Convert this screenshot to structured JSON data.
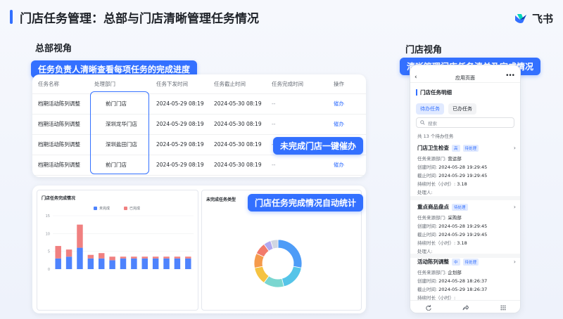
{
  "page": {
    "title": "门店任务管理：总部与门店清晰管理任务情况",
    "logo_text": "飞书"
  },
  "hq": {
    "heading": "总部视角",
    "pill_table": "任务负责人清晰查看每项任务的完成进度",
    "pill_remind": "未完成门店一键催办",
    "pill_stats": "门店任务完成情况自动统计",
    "table": {
      "headers": [
        "任务名称",
        "处理部门",
        "任务下发时间",
        "任务截止时间",
        "任务完成时间",
        "操作"
      ],
      "rows": [
        {
          "name": "档期活动陈列调整",
          "dept": "前门门店",
          "issued": "2024-05-29 08:19",
          "deadline": "2024-05-30 08:19",
          "done": "--",
          "action": "催办"
        },
        {
          "name": "档期活动陈列调整",
          "dept": "深圳龙华门店",
          "issued": "2024-05-29 08:19",
          "deadline": "2024-05-30 08:19",
          "done": "--",
          "action": "催办"
        },
        {
          "name": "档期活动陈列调整",
          "dept": "深圳盐田门店",
          "issued": "2024-05-29 08:19",
          "deadline": "2024-05-30 08:19",
          "done": "--",
          "action": "催办"
        },
        {
          "name": "档期活动陈列调整",
          "dept": "前门门店",
          "issued": "2024-05-29 08:19",
          "deadline": "2024-05-30 08:19",
          "done": "--",
          "action": "催办"
        }
      ]
    }
  },
  "chart_data": [
    {
      "type": "bar",
      "title": "门店任务完成情况",
      "series": [
        {
          "name": "未完成",
          "values": [
            3,
            3.5,
            6,
            3,
            3,
            2.5,
            3,
            3,
            3,
            3,
            3,
            3,
            3
          ]
        },
        {
          "name": "已完成",
          "values": [
            3.5,
            2,
            6.5,
            1,
            1.5,
            1,
            0.5,
            0.5,
            0.5,
            0.5,
            0.5,
            0.5,
            0.5
          ]
        }
      ],
      "ylim": [
        0,
        15
      ],
      "yticks": [
        0,
        5,
        10,
        15
      ],
      "colors": {
        "未完成": "#4e83fd",
        "已完成": "#f08080"
      }
    },
    {
      "type": "pie",
      "title": "未完成任务类型",
      "slices": [
        28,
        18,
        14,
        12,
        10,
        8,
        5,
        5
      ],
      "colors": [
        "#4e9cf7",
        "#55c4e8",
        "#7ad6d0",
        "#f5c342",
        "#f59a4b",
        "#f27a6b",
        "#b0a8f0",
        "#d0d6e2"
      ]
    }
  ],
  "store": {
    "heading": "门店视角",
    "pill": "清晰管理门店任务清单及完成情况",
    "app_title": "应用页面",
    "detail_title": "门店任务明细",
    "tab_pending": "待办任务",
    "tab_done": "已办任务",
    "search_placeholder": "搜索",
    "count_text": "共 13 个待办任务",
    "tasks": [
      {
        "title": "门店卫生检查",
        "level": "高",
        "status": "待处理",
        "dept_label": "任务来源部门:",
        "dept": "营运部",
        "created_label": "创建时间:",
        "created": "2024-05-28 19:29:45",
        "deadline_label": "截止时间:",
        "deadline": "2024-05-29 19:29:45",
        "duration_label": "持续时长（小时）:",
        "duration": "3.18",
        "handler_label": "处理人:"
      },
      {
        "title": "重点商品盘点",
        "level": "",
        "status": "待处理",
        "dept_label": "任务来源部门:",
        "dept": "采购部",
        "created_label": "创建时间:",
        "created": "2024-05-28 19:29:45",
        "deadline_label": "截止时间:",
        "deadline": "2024-05-29 19:29:45",
        "duration_label": "持续时长（小时）:",
        "duration": "3.18",
        "handler_label": "处理人:"
      },
      {
        "title": "活动陈列调整",
        "level": "中",
        "status": "待处理",
        "dept_label": "任务来源部门:",
        "dept": "企划部",
        "created_label": "创建时间:",
        "created": "2024-05-28 18:26:37",
        "deadline_label": "截止时间:",
        "deadline": "2024-05-29 18:26:37",
        "duration_label": "持续时长（小时）:",
        "duration": "",
        "handler_label": ""
      }
    ]
  }
}
